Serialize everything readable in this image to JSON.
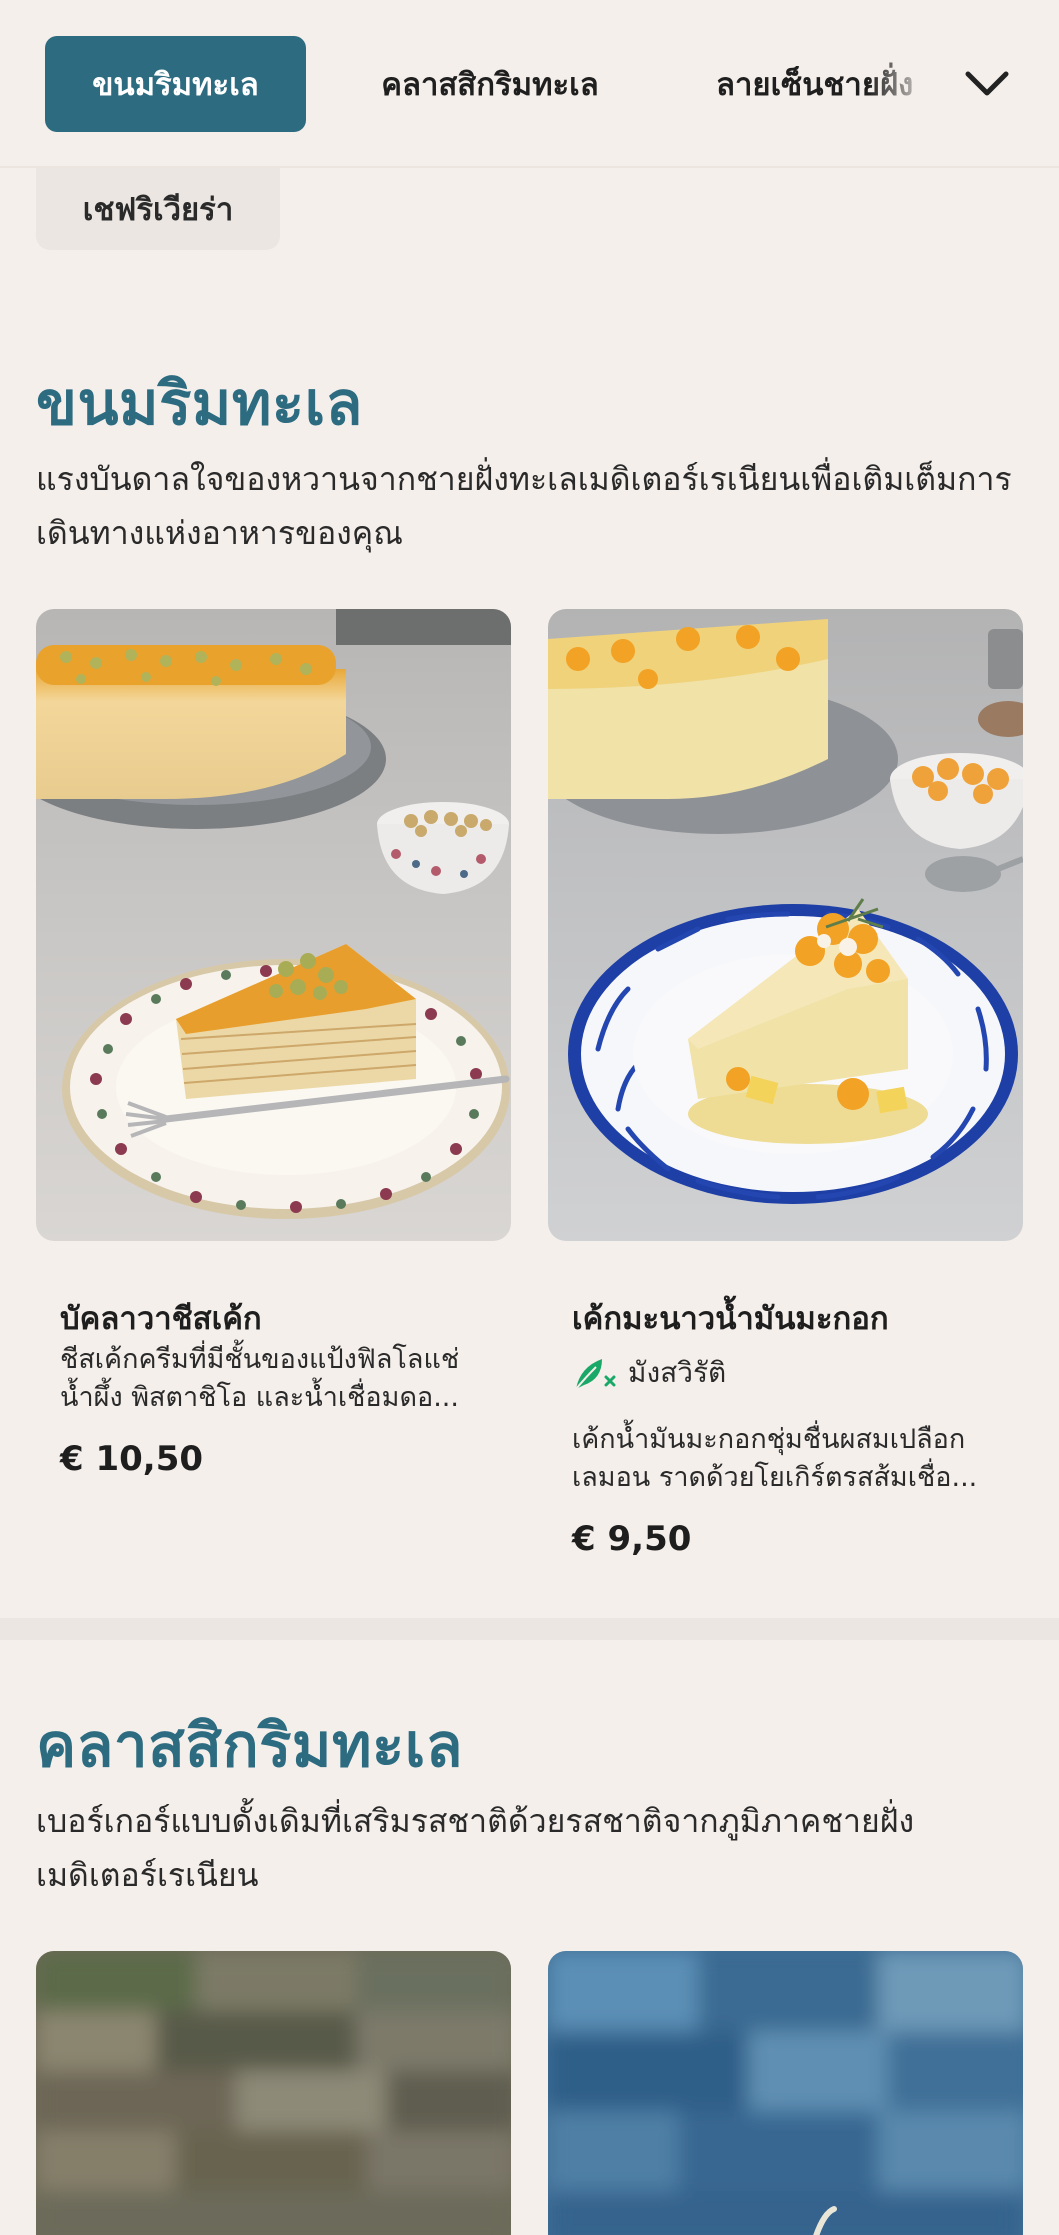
{
  "nav": {
    "tabs": [
      {
        "label": "ขนมริมทะเล",
        "active": true
      },
      {
        "label": "คลาสสิกริมทะเล",
        "active": false
      },
      {
        "label": "ลายเซ็นชายฝั่ง",
        "active": false
      }
    ],
    "expand_icon": "chevron-down-icon",
    "overflow_chip": "เชฟริเวียร่า"
  },
  "sections": [
    {
      "title": "ขนมริมทะเล",
      "description": "แรงบันดาลใจของหวานจากชายฝั่งทะเลเมดิเตอร์เรเนียนเพื่อเติมเต็มการเดินทางแห่งอาหารของคุณ",
      "items": [
        {
          "name": "บัคลาวาชีสเค้ก",
          "description": "ชีสเค้กครีมที่มีชั้นของแป้งฟิลโลแช่\nน้ำผึ้ง พิสตาชิโอ และน้ำเชื่อมดอ...",
          "price": "€ 10,50"
        },
        {
          "name": "เค้กมะนาวน้ำมันมะกอก",
          "badge": "มังสวิรัติ",
          "badge_icon": "vegetarian-leaf-icon",
          "description": "เค้กน้ำมันมะกอกชุ่มชื่นผสมเปลือก\nเลมอน ราดด้วยโยเกิร์ตรสส้มเชื่อ...",
          "price": "€ 9,50"
        }
      ]
    },
    {
      "title": "คลาสสิกริมทะเล",
      "description": "เบอร์เกอร์แบบดั้งเดิมที่เสริมรสชาติด้วยรสชาติจากภูมิภาคชายฝั่งเมดิเตอร์เรเนียน"
    }
  ],
  "colors": {
    "accent": "#2c6b80",
    "background": "#f5efeb",
    "veg_badge": "#1aa868"
  }
}
